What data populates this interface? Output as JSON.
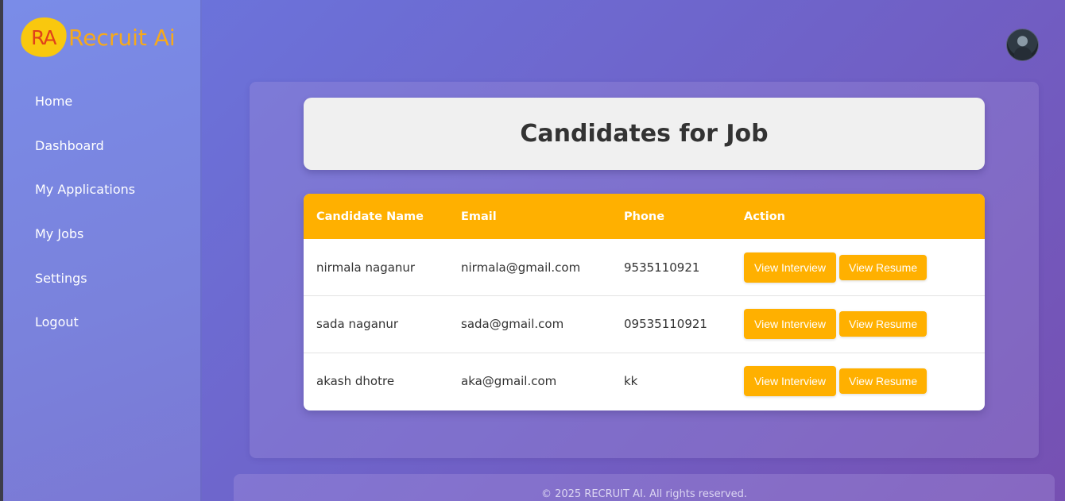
{
  "app": {
    "logo_mark": "RA",
    "logo_text": "Recruit Ai"
  },
  "sidebar": {
    "items": [
      {
        "label": "Home"
      },
      {
        "label": "Dashboard"
      },
      {
        "label": "My Applications"
      },
      {
        "label": "My Jobs"
      },
      {
        "label": "Settings"
      },
      {
        "label": "Logout"
      }
    ]
  },
  "header": {
    "avatar_icon": "user-avatar"
  },
  "page": {
    "title": "Candidates for Job"
  },
  "table": {
    "columns": [
      "Candidate Name",
      "Email",
      "Phone",
      "Action"
    ],
    "rows": [
      {
        "name": "nirmala naganur",
        "email": "nirmala@gmail.com",
        "phone": "9535110921"
      },
      {
        "name": "sada naganur",
        "email": "sada@gmail.com",
        "phone": "09535110921"
      },
      {
        "name": "akash dhotre",
        "email": "aka@gmail.com",
        "phone": "kk"
      }
    ],
    "actions": {
      "view_interview": "View Interview",
      "view_resume": "View Resume"
    }
  },
  "footer": {
    "text": "© 2025 RECRUIT AI. All rights reserved."
  },
  "colors": {
    "accent": "#ffb000",
    "logo_yellow": "#f9c80e",
    "logo_red": "#e0401a",
    "logo_orange": "#f6a91c"
  }
}
